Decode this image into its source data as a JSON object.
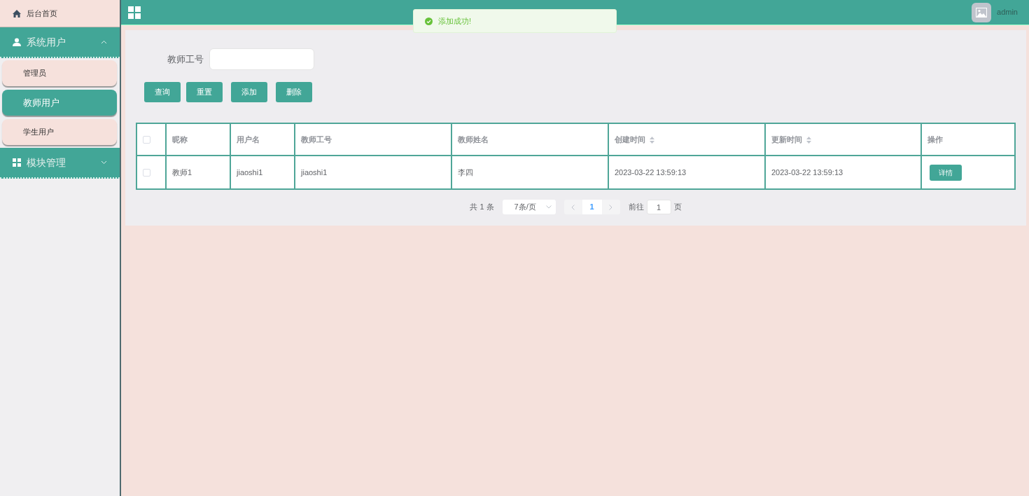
{
  "header": {
    "user": "admin"
  },
  "toast": {
    "message": "添加成功!"
  },
  "sidebar": {
    "home": {
      "label": "后台首页"
    },
    "groups": [
      {
        "label": "系统用户",
        "expanded": true,
        "items": [
          {
            "label": "管理员",
            "selected": false
          },
          {
            "label": "教师用户",
            "selected": true
          },
          {
            "label": "学生用户",
            "selected": false
          }
        ]
      },
      {
        "label": "模块管理",
        "expanded": false
      }
    ]
  },
  "search": {
    "label": "教师工号"
  },
  "buttons": [
    "查询",
    "重置",
    "添加",
    "删除"
  ],
  "table": {
    "select_all": {
      "checked": false
    },
    "columns": [
      {
        "label": "昵称",
        "sortable": false
      },
      {
        "label": "用户名",
        "sortable": false
      },
      {
        "label": "教师工号",
        "sortable": false
      },
      {
        "label": "教师姓名",
        "sortable": false
      },
      {
        "label": "创建时间",
        "sortable": true
      },
      {
        "label": "更新时间",
        "sortable": true
      },
      {
        "label": "操作",
        "sortable": false
      }
    ],
    "rows": [
      {
        "checked": false,
        "cells": [
          "教师1",
          "jiaoshi1",
          "jiaoshi1",
          "李四",
          "2023-03-22 13:59:13",
          "2023-03-22 13:59:13"
        ],
        "action": "详情"
      }
    ]
  },
  "pagination": {
    "total": "共 1 条",
    "page_size": "7条/页",
    "pages": [
      {
        "label": "1",
        "selected": true
      }
    ],
    "goto_label": "前往",
    "goto_value": "1",
    "unit": "页"
  }
}
